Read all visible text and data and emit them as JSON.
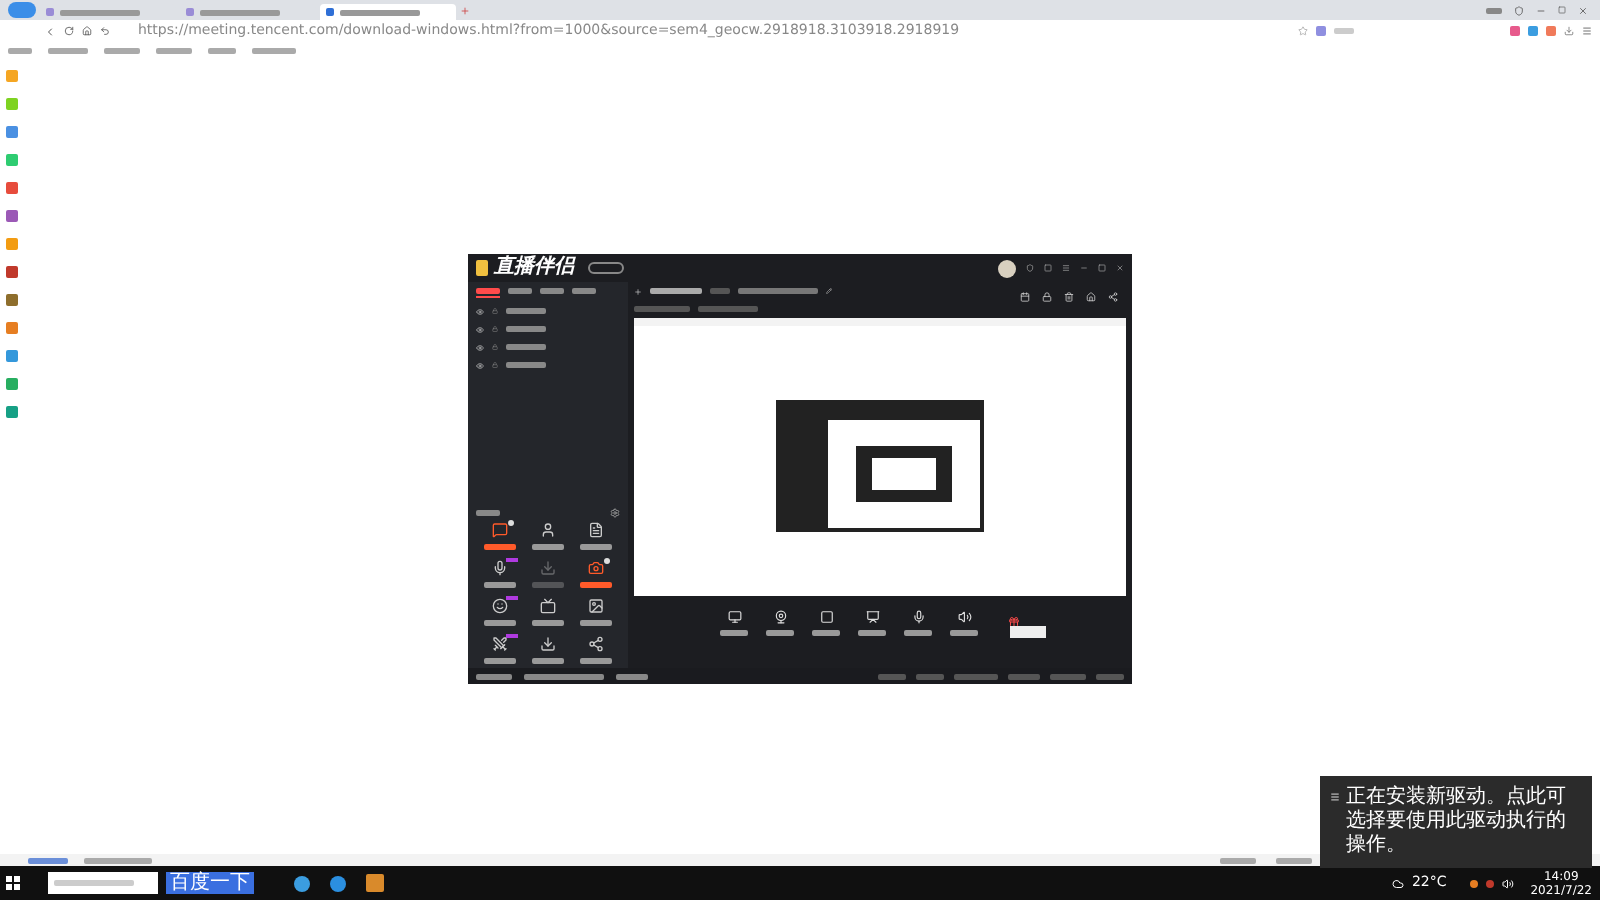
{
  "browser": {
    "tabs": [
      {
        "selected": false
      },
      {
        "selected": false
      },
      {
        "selected": true
      }
    ],
    "url": "https://meeting.tencent.com/download-windows.html?from=1000&source=sem4_geocw.2918918.3103918.2918919"
  },
  "sidebar": {
    "items": [
      {
        "color": "#f5a623"
      },
      {
        "color": "#7ed321"
      },
      {
        "color": "#4a90e2"
      },
      {
        "color": "#2ecc71"
      },
      {
        "color": "#e74c3c"
      },
      {
        "color": "#9b59b6"
      },
      {
        "color": "#f39c12"
      },
      {
        "color": "#c0392b"
      },
      {
        "color": "#8e6e2c"
      },
      {
        "color": "#e67e22"
      },
      {
        "color": "#3498db"
      },
      {
        "color": "#27ae60"
      },
      {
        "color": "#16a085"
      }
    ]
  },
  "app": {
    "name": "直播伴侣",
    "scene_tabs": [
      {
        "selected": true
      },
      {
        "selected": false
      },
      {
        "selected": false
      },
      {
        "selected": false
      }
    ],
    "sources": [
      {
        "visible": true
      },
      {
        "visible": true
      },
      {
        "visible": true
      },
      {
        "visible": true
      }
    ],
    "tools": [
      {
        "active": true,
        "disabled": false,
        "dot": true,
        "new_tag": false
      },
      {
        "active": false,
        "disabled": false,
        "dot": false,
        "new_tag": false
      },
      {
        "active": false,
        "disabled": false,
        "dot": false,
        "new_tag": false
      },
      {
        "active": false,
        "disabled": false,
        "dot": false,
        "new_tag": true
      },
      {
        "active": false,
        "disabled": true,
        "dot": false,
        "new_tag": false
      },
      {
        "active": true,
        "disabled": false,
        "dot": true,
        "new_tag": false
      },
      {
        "active": false,
        "disabled": false,
        "dot": false,
        "new_tag": true
      },
      {
        "active": false,
        "disabled": false,
        "dot": false,
        "new_tag": false
      },
      {
        "active": false,
        "disabled": false,
        "dot": false,
        "new_tag": false
      },
      {
        "active": false,
        "disabled": false,
        "dot": false,
        "new_tag": true
      },
      {
        "active": false,
        "disabled": false,
        "dot": false,
        "new_tag": false
      },
      {
        "active": false,
        "disabled": false,
        "dot": false,
        "new_tag": false
      }
    ]
  },
  "notification": {
    "text": "正在安装新驱动。点此可选择要使用此驱动执行的操作。"
  },
  "taskbar": {
    "search_button": "百度一下",
    "weather": "22°C",
    "time": "14:09",
    "date": "2021/7/22"
  }
}
